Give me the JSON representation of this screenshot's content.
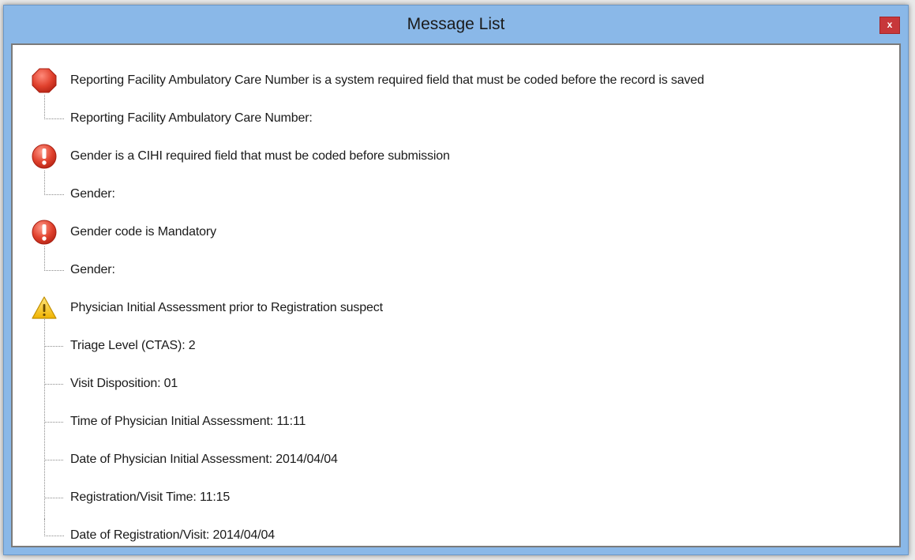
{
  "window": {
    "title": "Message List",
    "close_label": "x"
  },
  "messages": [
    {
      "severity": "stop",
      "icon": "stop-icon",
      "text": "Reporting Facility Ambulatory Care Number is a system required field that must be coded before the record is saved",
      "fields": [
        "Reporting Facility Ambulatory Care Number:"
      ]
    },
    {
      "severity": "error",
      "icon": "error-icon",
      "text": "Gender is a CIHI required field that must be coded before submission",
      "fields": [
        "Gender:"
      ]
    },
    {
      "severity": "error",
      "icon": "error-icon",
      "text": "Gender code is Mandatory",
      "fields": [
        "Gender:"
      ]
    },
    {
      "severity": "warning",
      "icon": "warning-icon",
      "text": "Physician Initial Assessment prior to Registration suspect",
      "fields": [
        "Triage Level (CTAS): 2",
        "Visit Disposition: 01",
        "Time of Physician Initial Assessment: 11:11",
        "Date of Physician Initial Assessment: 2014/04/04",
        "Registration/Visit Time: 11:15",
        "Date of Registration/Visit: 2014/04/04"
      ]
    }
  ],
  "colors": {
    "title_bar": "#8ab8e8",
    "close_button": "#c7373a",
    "stop": "#e0412d",
    "error": "#e0412d",
    "warning": "#f5c518"
  }
}
